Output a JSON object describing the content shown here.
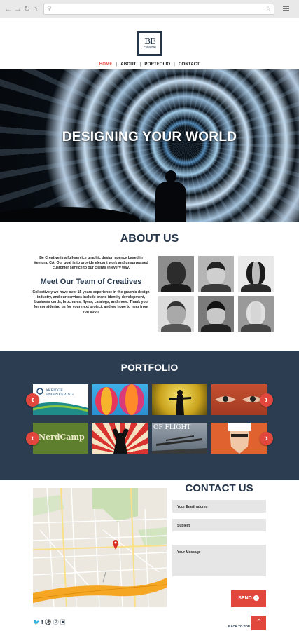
{
  "browser": {
    "back_icon": "arrow-left-icon",
    "forward_icon": "arrow-right-icon",
    "reload_icon": "reload-icon",
    "home_icon": "home-icon",
    "menu_icon": "hamburger-icon"
  },
  "header": {
    "logo_mark": "BE",
    "logo_text": "creative",
    "nav": [
      "HOME",
      "ABOUT",
      "PORTFOLIO",
      "CONTACT"
    ],
    "active_nav": "HOME"
  },
  "hero": {
    "title": "DESIGNING YOUR WORLD"
  },
  "about": {
    "title": "ABOUT US",
    "intro": "Be Creative is a full-service graphic design agency based in Ventura, CA. Our goal is to provide elegant work and unsurpassed customer service to our clients in every way.",
    "team_title": "Meet Our Team of Creatives",
    "team_text": "Collectively we have over 15 years experience in the graphic design industry, and our services include brand identity development, business cards, brochures, flyers, catalogs, and more. Thank you for considering us for your next project, and we hope to hear from you soon."
  },
  "portfolio": {
    "title": "PORTFOLIO",
    "row1": [
      "AKRIDGE ENGINEERING",
      "",
      "",
      ""
    ],
    "row2": [
      "NerdCamp",
      "",
      "OF FLIGHT",
      ""
    ]
  },
  "contact": {
    "title": "CONTACT US",
    "email_label": "Your Email addres",
    "subject_label": "Subject",
    "message_label": "Your Message",
    "send_label": "SEND",
    "back_to_top": "BACK TO TOP",
    "social": [
      "twitter-icon",
      "facebook-icon",
      "dribbble-icon",
      "pinterest-icon",
      "instagram-icon"
    ]
  },
  "colors": {
    "accent": "#e2473d",
    "navy": "#26364a",
    "portfolio_bg": "#2c3d52"
  }
}
